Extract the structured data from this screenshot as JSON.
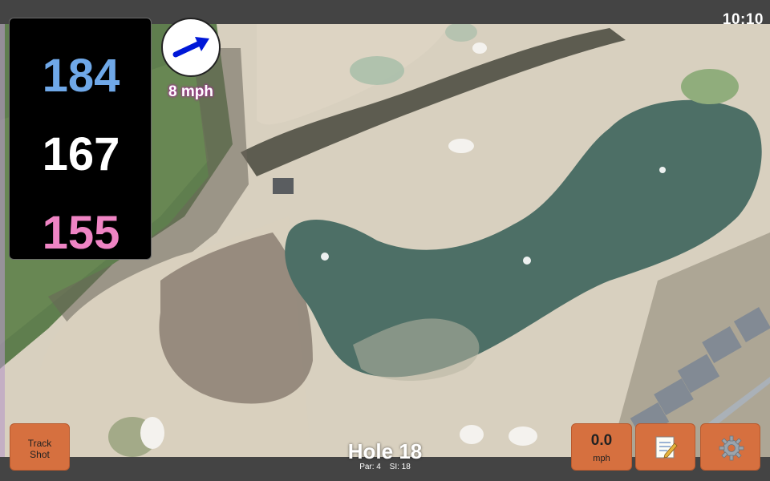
{
  "status_bar": {
    "time": "10:10"
  },
  "yardages": {
    "back": "184",
    "middle": "167",
    "front": "155"
  },
  "wind": {
    "speed_label": "8 mph",
    "icon": "wind-arrow-icon"
  },
  "buttons": {
    "track_shot_line1": "Track",
    "track_shot_line2": "Shot",
    "speed_value": "0.0",
    "speed_unit": "mph",
    "notes_icon": "notepad-icon",
    "settings_icon": "gear-icon"
  },
  "hole": {
    "title": "Hole 18",
    "par": "Par: 4",
    "si": "SI: 18"
  },
  "colors": {
    "back": "#6fa8e8",
    "middle": "#ffffff",
    "front": "#ef84c4",
    "button": "#d6703f"
  }
}
